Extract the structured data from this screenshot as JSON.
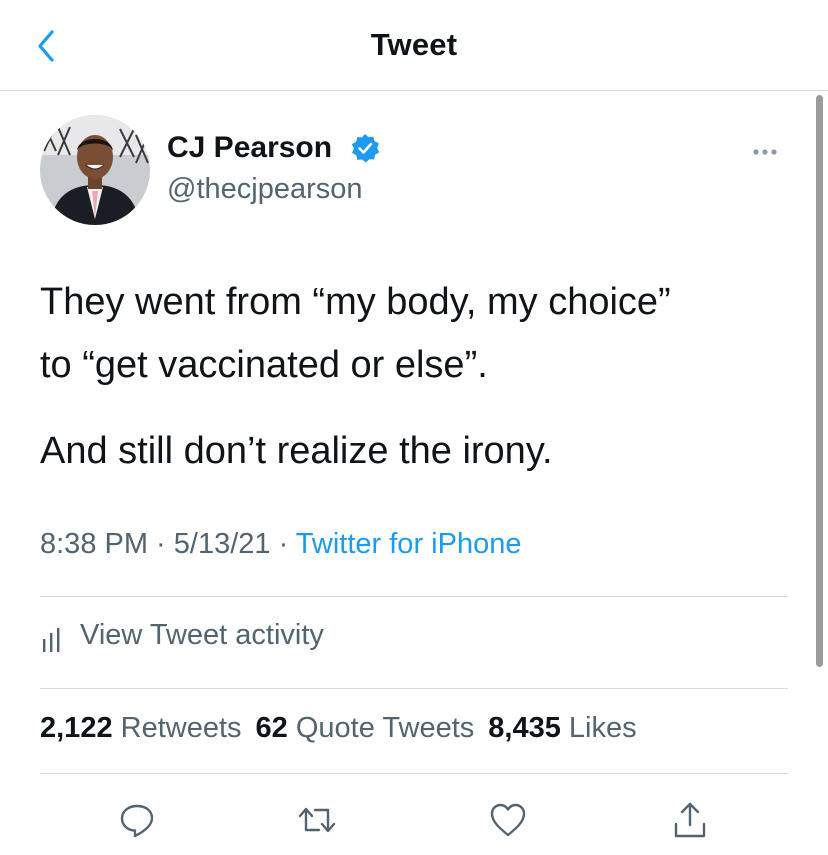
{
  "header": {
    "title": "Tweet",
    "back_icon": "chevron-left-icon"
  },
  "colors": {
    "accent": "#1d9bf0",
    "text": "#0f1419",
    "secondary": "#536471",
    "divider": "#d9d9d9"
  },
  "author": {
    "display_name": "CJ Pearson",
    "handle": "@thecjpearson",
    "verified": true
  },
  "tweet": {
    "lines": [
      "They went from “my body, my choice”",
      "to “get vaccinated or else”.",
      "And still don’t realize the irony."
    ],
    "time": "8:38 PM",
    "date": "5/13/21",
    "source": "Twitter for iPhone",
    "separator": " · "
  },
  "activity": {
    "label": "View Tweet activity",
    "icon": "bar-chart-icon"
  },
  "stats": {
    "retweets_count": "2,122",
    "retweets_label": "Retweets",
    "quotes_count": "62",
    "quotes_label": "Quote Tweets",
    "likes_count": "8,435",
    "likes_label": "Likes"
  },
  "actions": [
    "reply-icon",
    "retweet-icon",
    "like-icon",
    "share-icon"
  ]
}
